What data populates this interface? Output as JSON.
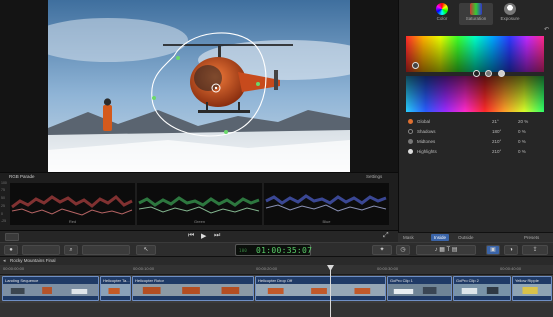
{
  "inspector": {
    "tabs": [
      {
        "label": "Color",
        "icon": "color-wheel-icon"
      },
      {
        "label": "Saturation",
        "icon": "saturation-icon"
      },
      {
        "label": "Exposure",
        "icon": "exposure-icon"
      }
    ],
    "rows": [
      {
        "label": "Global",
        "v1": "21°",
        "v2": "20 %"
      },
      {
        "label": "Shadows",
        "v1": "180°",
        "v2": "0 %"
      },
      {
        "label": "Midtones",
        "v1": "210°",
        "v2": "0 %"
      },
      {
        "label": "Highlights",
        "v1": "210°",
        "v2": "0 %"
      }
    ],
    "bottom_tabs": {
      "mask": "Mask",
      "inside": "Inside",
      "outside": "Outside",
      "presets": "Presets"
    }
  },
  "scopes": {
    "title": "RGB Parade",
    "settings": "Settings",
    "scale": [
      "100",
      "75",
      "50",
      "25",
      "0",
      "-25"
    ],
    "channels": [
      {
        "label": "Red",
        "color": "#e05050"
      },
      {
        "label": "Green",
        "color": "#49d06a"
      },
      {
        "label": "Blue",
        "color": "#5a70f0"
      }
    ]
  },
  "toolbar": {
    "timecode": "01:00:35:07",
    "timecode_mini": "100"
  },
  "timeline": {
    "project": "Rocky Mountains Final",
    "ruler": [
      "00:00:00:00",
      "00:00:10:00",
      "00:00:20:00",
      "00:00:30:00",
      "00:00:40:00"
    ],
    "clips": [
      "Landing Sequence",
      "Helicopter Ta...",
      "Helicopter Rotor",
      "Helicopter Drop Off",
      "GoPro Clip 1",
      "GoPro Clip 2",
      "Yellow Ripple"
    ]
  },
  "colors": {
    "accent": "#3a64a8",
    "timecode_green": "#5ad06a",
    "clip_blue": "#1f3a66"
  }
}
